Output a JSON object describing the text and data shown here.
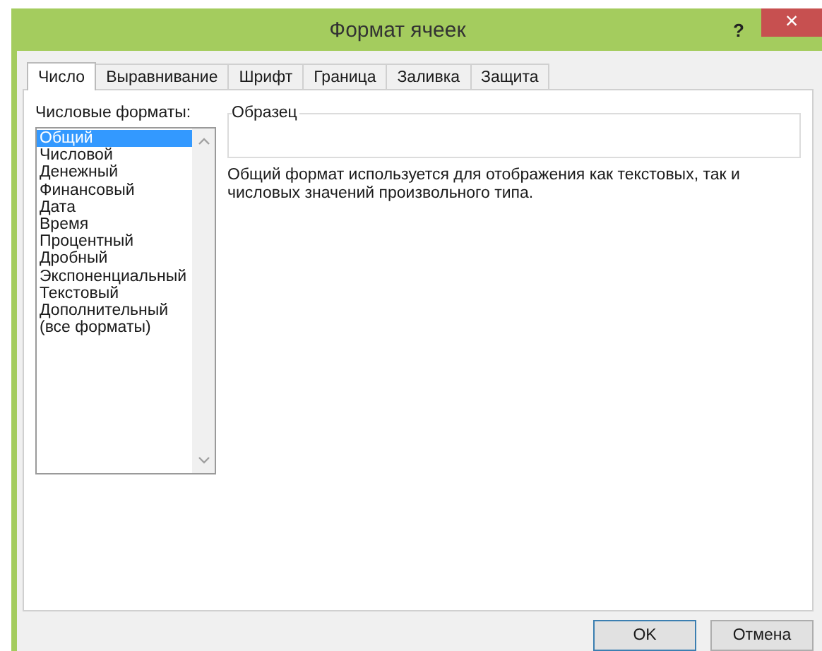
{
  "window": {
    "title": "Формат ячеек",
    "help": "?",
    "close": "×"
  },
  "tabs": [
    {
      "label": "Число",
      "selected": true
    },
    {
      "label": "Выравнивание",
      "selected": false
    },
    {
      "label": "Шрифт",
      "selected": false
    },
    {
      "label": "Граница",
      "selected": false
    },
    {
      "label": "Заливка",
      "selected": false
    },
    {
      "label": "Защита",
      "selected": false
    }
  ],
  "formats_label": "Числовые форматы:",
  "formats": [
    {
      "label": "Общий",
      "selected": true
    },
    {
      "label": "Числовой",
      "selected": false
    },
    {
      "label": "Денежный",
      "selected": false
    },
    {
      "label": "Финансовый",
      "selected": false
    },
    {
      "label": "Дата",
      "selected": false
    },
    {
      "label": "Время",
      "selected": false
    },
    {
      "label": "Процентный",
      "selected": false
    },
    {
      "label": "Дробный",
      "selected": false
    },
    {
      "label": "Экспоненциальный",
      "selected": false
    },
    {
      "label": "Текстовый",
      "selected": false
    },
    {
      "label": "Дополнительный",
      "selected": false
    },
    {
      "label": "(все форматы)",
      "selected": false
    }
  ],
  "sample": {
    "label": "Образец"
  },
  "description": "Общий формат используется для отображения как текстовых, так и числовых значений произвольного типа.",
  "buttons": [
    "OK",
    "Отмена"
  ]
}
